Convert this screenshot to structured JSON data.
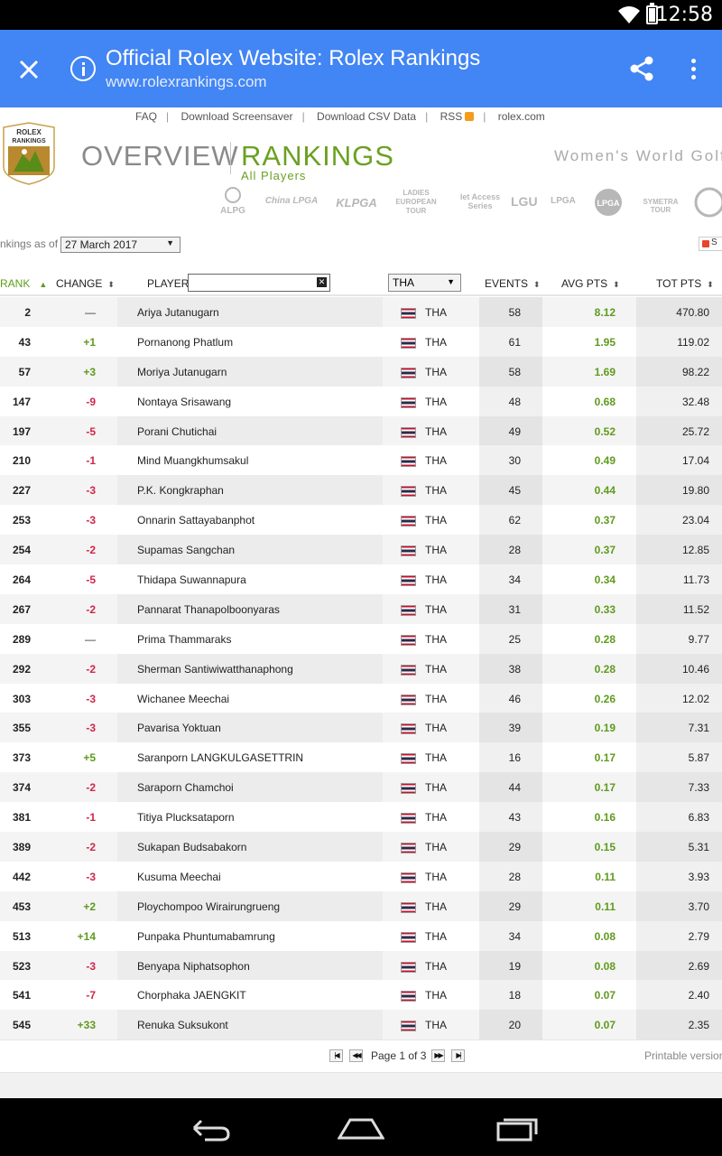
{
  "status_bar": {
    "time": "12:58"
  },
  "tab_bar": {
    "title": "Official Rolex Website: Rolex Rankings",
    "url": "www.rolexrankings.com"
  },
  "top_links": [
    "FAQ",
    "Download Screensaver",
    "Download CSV Data",
    "RSS",
    "rolex.com"
  ],
  "header": {
    "logo_text_1": "ROLEX",
    "logo_text_2": "RANKINGS",
    "overview": "OVERVIEW",
    "rankings": "RANKINGS",
    "subtitle": "All Players",
    "tagline": "Women's World Golf"
  },
  "tour_logos": [
    "ALPG",
    "China LPGA",
    "KLPGA",
    "LADIES EUROPEAN TOUR",
    "let Access Series",
    "LGU",
    "LPGA",
    "LPGA",
    "SYMETRA TOUR"
  ],
  "rankings_as_of": {
    "label": "nkings as of",
    "value": "27 March 2017"
  },
  "share_button": "S",
  "table": {
    "headers": {
      "rank": "RANK",
      "change": "CHANGE",
      "player": "PLAYER",
      "country": "THA",
      "events": "EVENTS",
      "avg_pts": "AVG PTS",
      "tot_pts": "TOT PTS"
    },
    "player_filter_value": "",
    "rows": [
      {
        "rank": "2",
        "change": "—",
        "player": "Ariya Jutanugarn",
        "country": "THA",
        "events": "58",
        "avg": "8.12",
        "tot": "470.80"
      },
      {
        "rank": "43",
        "change": "+1",
        "player": "Pornanong Phatlum",
        "country": "THA",
        "events": "61",
        "avg": "1.95",
        "tot": "119.02"
      },
      {
        "rank": "57",
        "change": "+3",
        "player": "Moriya Jutanugarn",
        "country": "THA",
        "events": "58",
        "avg": "1.69",
        "tot": "98.22"
      },
      {
        "rank": "147",
        "change": "-9",
        "player": "Nontaya Srisawang",
        "country": "THA",
        "events": "48",
        "avg": "0.68",
        "tot": "32.48"
      },
      {
        "rank": "197",
        "change": "-5",
        "player": "Porani Chutichai",
        "country": "THA",
        "events": "49",
        "avg": "0.52",
        "tot": "25.72"
      },
      {
        "rank": "210",
        "change": "-1",
        "player": "Mind Muangkhumsakul",
        "country": "THA",
        "events": "30",
        "avg": "0.49",
        "tot": "17.04"
      },
      {
        "rank": "227",
        "change": "-3",
        "player": "P.K. Kongkraphan",
        "country": "THA",
        "events": "45",
        "avg": "0.44",
        "tot": "19.80"
      },
      {
        "rank": "253",
        "change": "-3",
        "player": "Onnarin Sattayabanphot",
        "country": "THA",
        "events": "62",
        "avg": "0.37",
        "tot": "23.04"
      },
      {
        "rank": "254",
        "change": "-2",
        "player": "Supamas Sangchan",
        "country": "THA",
        "events": "28",
        "avg": "0.37",
        "tot": "12.85"
      },
      {
        "rank": "264",
        "change": "-5",
        "player": "Thidapa Suwannapura",
        "country": "THA",
        "events": "34",
        "avg": "0.34",
        "tot": "11.73"
      },
      {
        "rank": "267",
        "change": "-2",
        "player": "Pannarat Thanapolboonyaras",
        "country": "THA",
        "events": "31",
        "avg": "0.33",
        "tot": "11.52"
      },
      {
        "rank": "289",
        "change": "—",
        "player": "Prima Thammaraks",
        "country": "THA",
        "events": "25",
        "avg": "0.28",
        "tot": "9.77"
      },
      {
        "rank": "292",
        "change": "-2",
        "player": "Sherman Santiwiwatthanaphong",
        "country": "THA",
        "events": "38",
        "avg": "0.28",
        "tot": "10.46"
      },
      {
        "rank": "303",
        "change": "-3",
        "player": "Wichanee Meechai",
        "country": "THA",
        "events": "46",
        "avg": "0.26",
        "tot": "12.02"
      },
      {
        "rank": "355",
        "change": "-3",
        "player": "Pavarisa Yoktuan",
        "country": "THA",
        "events": "39",
        "avg": "0.19",
        "tot": "7.31"
      },
      {
        "rank": "373",
        "change": "+5",
        "player": "Saranporn LANGKULGASETTRIN",
        "country": "THA",
        "events": "16",
        "avg": "0.17",
        "tot": "5.87"
      },
      {
        "rank": "374",
        "change": "-2",
        "player": "Saraporn Chamchoi",
        "country": "THA",
        "events": "44",
        "avg": "0.17",
        "tot": "7.33"
      },
      {
        "rank": "381",
        "change": "-1",
        "player": "Titiya Plucksataporn",
        "country": "THA",
        "events": "43",
        "avg": "0.16",
        "tot": "6.83"
      },
      {
        "rank": "389",
        "change": "-2",
        "player": "Sukapan Budsabakorn",
        "country": "THA",
        "events": "29",
        "avg": "0.15",
        "tot": "5.31"
      },
      {
        "rank": "442",
        "change": "-3",
        "player": "Kusuma Meechai",
        "country": "THA",
        "events": "28",
        "avg": "0.11",
        "tot": "3.93"
      },
      {
        "rank": "453",
        "change": "+2",
        "player": "Ploychompoo Wirairungrueng",
        "country": "THA",
        "events": "29",
        "avg": "0.11",
        "tot": "3.70"
      },
      {
        "rank": "513",
        "change": "+14",
        "player": "Punpaka Phuntumabamrung",
        "country": "THA",
        "events": "34",
        "avg": "0.08",
        "tot": "2.79"
      },
      {
        "rank": "523",
        "change": "-3",
        "player": "Benyapa Niphatsophon",
        "country": "THA",
        "events": "19",
        "avg": "0.08",
        "tot": "2.69"
      },
      {
        "rank": "541",
        "change": "-7",
        "player": "Chorphaka JAENGKIT",
        "country": "THA",
        "events": "18",
        "avg": "0.07",
        "tot": "2.40"
      },
      {
        "rank": "545",
        "change": "+33",
        "player": "Renuka Suksukont",
        "country": "THA",
        "events": "20",
        "avg": "0.07",
        "tot": "2.35"
      }
    ]
  },
  "pager": {
    "label": "Page 1 of 3"
  },
  "printable": "Printable version",
  "colors": {
    "chrome_blue": "#4285f4",
    "rolex_green": "#6aa121",
    "down_red": "#d0254a"
  }
}
